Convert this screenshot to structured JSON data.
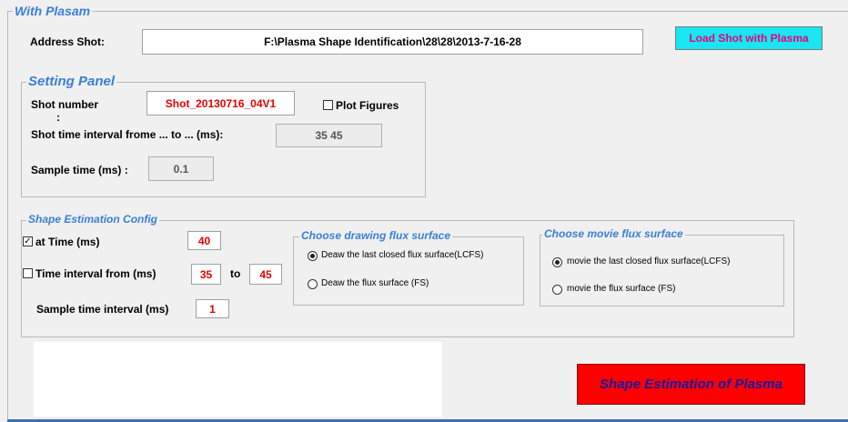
{
  "main_panel": {
    "title": "With Plasam"
  },
  "address": {
    "label": "Address Shot:",
    "value": "F:\\Plasma Shape Identification\\28\\28\\2013-7-16-28"
  },
  "load_button": {
    "label": "Load Shot with Plasma"
  },
  "setting_panel": {
    "title": "Setting Panel",
    "shot_number_label": "Shot number",
    "shot_number_colon": ":",
    "shot_number_value": "Shot_20130716_04V1",
    "plot_figures_label": "Plot Figures",
    "plot_figures_checked": false,
    "shot_interval_label": "Shot time  interval frome ... to ... (ms):",
    "shot_interval_value": "35 45",
    "sample_time_label": "Sample time (ms) :",
    "sample_time_value": "0.1"
  },
  "shape_config": {
    "title": "Shape Estimation Config",
    "at_time_label": "at Time (ms)",
    "at_time_checked": true,
    "at_time_value": "40",
    "interval_label": "Time interval from (ms)",
    "interval_checked": false,
    "interval_from": "35",
    "interval_to_label": "to",
    "interval_to": "45",
    "sample_interval_label": "Sample time interval (ms)",
    "sample_interval_value": "1",
    "drawing_group": {
      "title": "Choose drawing flux surface",
      "option1": "Deaw the last closed flux surface(LCFS)",
      "option2": "Deaw the  flux surface (FS)",
      "selected": 1
    },
    "movie_group": {
      "title": "Choose movie flux surface",
      "option1": "movie the last closed flux surface(LCFS)",
      "option2": "movie the  flux surface (FS)",
      "selected": 1
    }
  },
  "estimate_button": {
    "label": "Shape Estimation of Plasma"
  },
  "colors": {
    "accent": "#3a7fd5",
    "load_button_bg": "#19e6f0",
    "load_button_text": "#e6007e",
    "estimate_button_bg": "#ff0000",
    "value_red": "#e60000"
  }
}
